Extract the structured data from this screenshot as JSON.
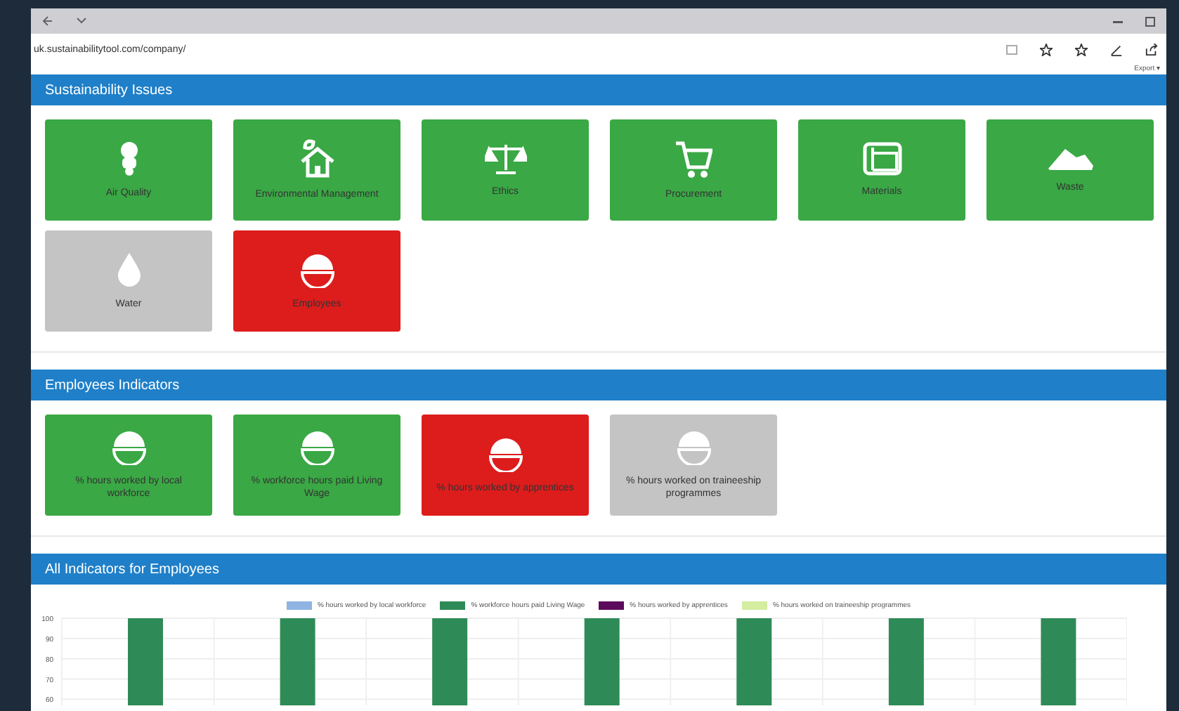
{
  "browser": {
    "url": "uk.sustainabilitytool.com/company/",
    "export": "Export ▾"
  },
  "sections": [
    {
      "title": "Sustainability Issues",
      "tiles": [
        {
          "label": "Air Quality",
          "color": "#3aa845",
          "kind": "mask"
        },
        {
          "label": "Environmental Management",
          "color": "#3aa845",
          "kind": "house"
        },
        {
          "label": "Ethics",
          "color": "#3aa845",
          "kind": "scales"
        },
        {
          "label": "Procurement",
          "color": "#3aa845",
          "kind": "cart"
        },
        {
          "label": "Materials",
          "color": "#3aa845",
          "kind": "sheets"
        },
        {
          "label": "Waste",
          "color": "#3aa845",
          "kind": "waste"
        },
        {
          "label": "Water",
          "color": "#c4c4c4",
          "kind": "drop"
        },
        {
          "label": "Employees",
          "color": "#dd1c1c",
          "kind": "helmet"
        }
      ]
    },
    {
      "title": "Employees Indicators",
      "tiles": [
        {
          "label": "% hours worked by local workforce",
          "color": "#3aa845",
          "kind": "helmet"
        },
        {
          "label": "% workforce hours paid Living Wage",
          "color": "#3aa845",
          "kind": "helmet"
        },
        {
          "label": "% hours worked by apprentices",
          "color": "#dd1c1c",
          "kind": "helmet"
        },
        {
          "label": "% hours worked on traineeship programmes",
          "color": "#c4c4c4",
          "kind": "helmet"
        }
      ]
    }
  ],
  "chart_section": {
    "title": "All Indicators for Employees",
    "chart_data": {
      "type": "bar",
      "grid": true,
      "ylim": [
        57,
        100
      ],
      "yticks": [
        100,
        90,
        80,
        70,
        60
      ],
      "series": [
        {
          "name": "% hours worked by local workforce",
          "color": "#8fb4e3",
          "values": [
            null,
            null,
            null,
            null,
            null,
            null,
            null
          ]
        },
        {
          "name": "% workforce hours paid Living Wage",
          "color": "#2e8b57",
          "values": [
            100,
            100,
            100,
            100,
            100,
            100,
            100
          ]
        },
        {
          "name": "% hours worked by apprentices",
          "color": "#5c0a5c",
          "values": [
            null,
            null,
            null,
            null,
            null,
            null,
            null
          ]
        },
        {
          "name": "% hours worked on traineeship programmes",
          "color": "#d4eda0",
          "values": [
            null,
            null,
            null,
            null,
            null,
            null,
            null
          ]
        }
      ]
    }
  }
}
